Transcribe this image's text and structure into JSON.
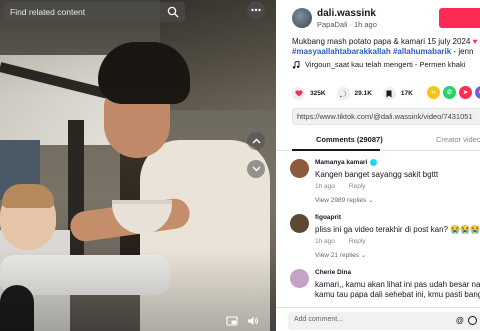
{
  "video": {
    "search_placeholder": "Find related content",
    "icons": [
      "search-icon",
      "more-icon",
      "chevron-up-icon",
      "chevron-down-icon",
      "pip-icon",
      "volume-icon"
    ]
  },
  "author": {
    "username": "dali.wassink",
    "display_name": "PapaDali",
    "separator": "·",
    "posted": "1h ago"
  },
  "caption": {
    "line1": "Mukbang mash potato papa & kamari 15 july 2024",
    "line2_hashtags": "#masyaallahtabarakkallah #allahumabarik",
    "line2_tail": " - jenn"
  },
  "music": "Virgoun_saat kau telah mengerti - Permen khaki",
  "stats": {
    "likes": "325K",
    "comments": "29.1K",
    "bookmarks": "17K"
  },
  "share_colors": [
    "#f5c518",
    "#25d366",
    "#fe2c55",
    "#7b5cd6",
    "#111111"
  ],
  "url": "https://www.tiktok.com/@dali.wassink/video/7431051",
  "tabs": {
    "comments": "Comments (29087)",
    "creator": "Creator video"
  },
  "comments": [
    {
      "name": "Mamanya kamari",
      "text": "Kangen banget sayangg sakit bgttt",
      "time": "1h ago",
      "reply": "Reply",
      "replies": "View 2989 replies",
      "avatar_color": "#8c5a3c"
    },
    {
      "name": "figoaprit",
      "text": "pliss ini ga video terakhir di post kan? 😭😭😭",
      "time": "1h ago",
      "reply": "Reply",
      "replies": "View 21 replies",
      "avatar_color": "#5b4a2e"
    },
    {
      "name": "Cherie Dina",
      "text": "kamari,, kamu akan lihat ini pas udah besar nan",
      "text2": "kamu tau papa dali sehebat ini, kmu pasti bang",
      "avatar_color": "#c6a2c9"
    }
  ],
  "add_comment": {
    "placeholder": "Add comment...",
    "at": "@"
  }
}
